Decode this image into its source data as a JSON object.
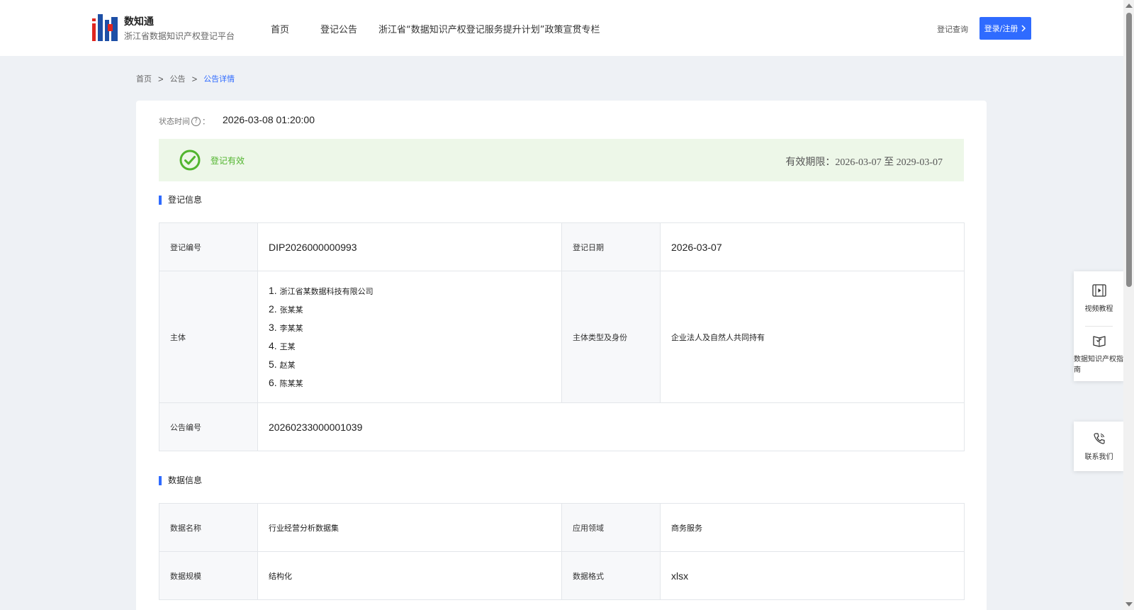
{
  "header": {
    "brand_name": "数知通",
    "brand_sub": "浙江省数据知识产权登记平台",
    "nav": [
      "首页",
      "登记公告",
      "浙江省“数据知识产权登记服务提升计划”政策宣贯专栏"
    ],
    "search_label": "登记查询",
    "login_label": "登录/注册"
  },
  "breadcrumb": {
    "items": [
      "首页",
      "公告",
      "公告详情"
    ]
  },
  "detail": {
    "status_time_label": "状态时间",
    "status_time_value": "2026-03-08 01:20:00",
    "status_text": "登记有效",
    "validity": "有效期限：2026-03-07 至 2029-03-07"
  },
  "sections": {
    "basic_title": "登记信息",
    "data_title": "数据信息"
  },
  "basic_info": {
    "cert_no_label": "登记编号",
    "cert_no_value": "DIP2026000000993",
    "date_label": "登记日期",
    "date_value": "2026-03-07",
    "holder_label": "主体",
    "holder_items": [
      {
        "n": "1.",
        "t": "浙江省某数据科技有限公司"
      },
      {
        "n": "2.",
        "t": "张某某"
      },
      {
        "n": "3.",
        "t": "李某某"
      },
      {
        "n": "4.",
        "t": "王某"
      },
      {
        "n": "5.",
        "t": "赵某"
      },
      {
        "n": "6.",
        "t": "陈某某"
      }
    ],
    "holder_type_label": "主体类型及身份",
    "holder_type_value": "企业法人及自然人共同持有",
    "pub_no_label": "公告编号",
    "pub_no_value": "20260233000001039"
  },
  "data_info": {
    "name_label": "数据名称",
    "name_value": "行业经营分析数据集",
    "field_label": "应用领域",
    "field_value": "商务服务",
    "scale_label": "数据规模",
    "scale_value": "结构化",
    "format_label": "数据格式",
    "format_value": "xlsx"
  },
  "float_panel": {
    "video_label": "视频教程",
    "guide_label": "数据知识产权指南",
    "contact_label": "联系我们"
  }
}
